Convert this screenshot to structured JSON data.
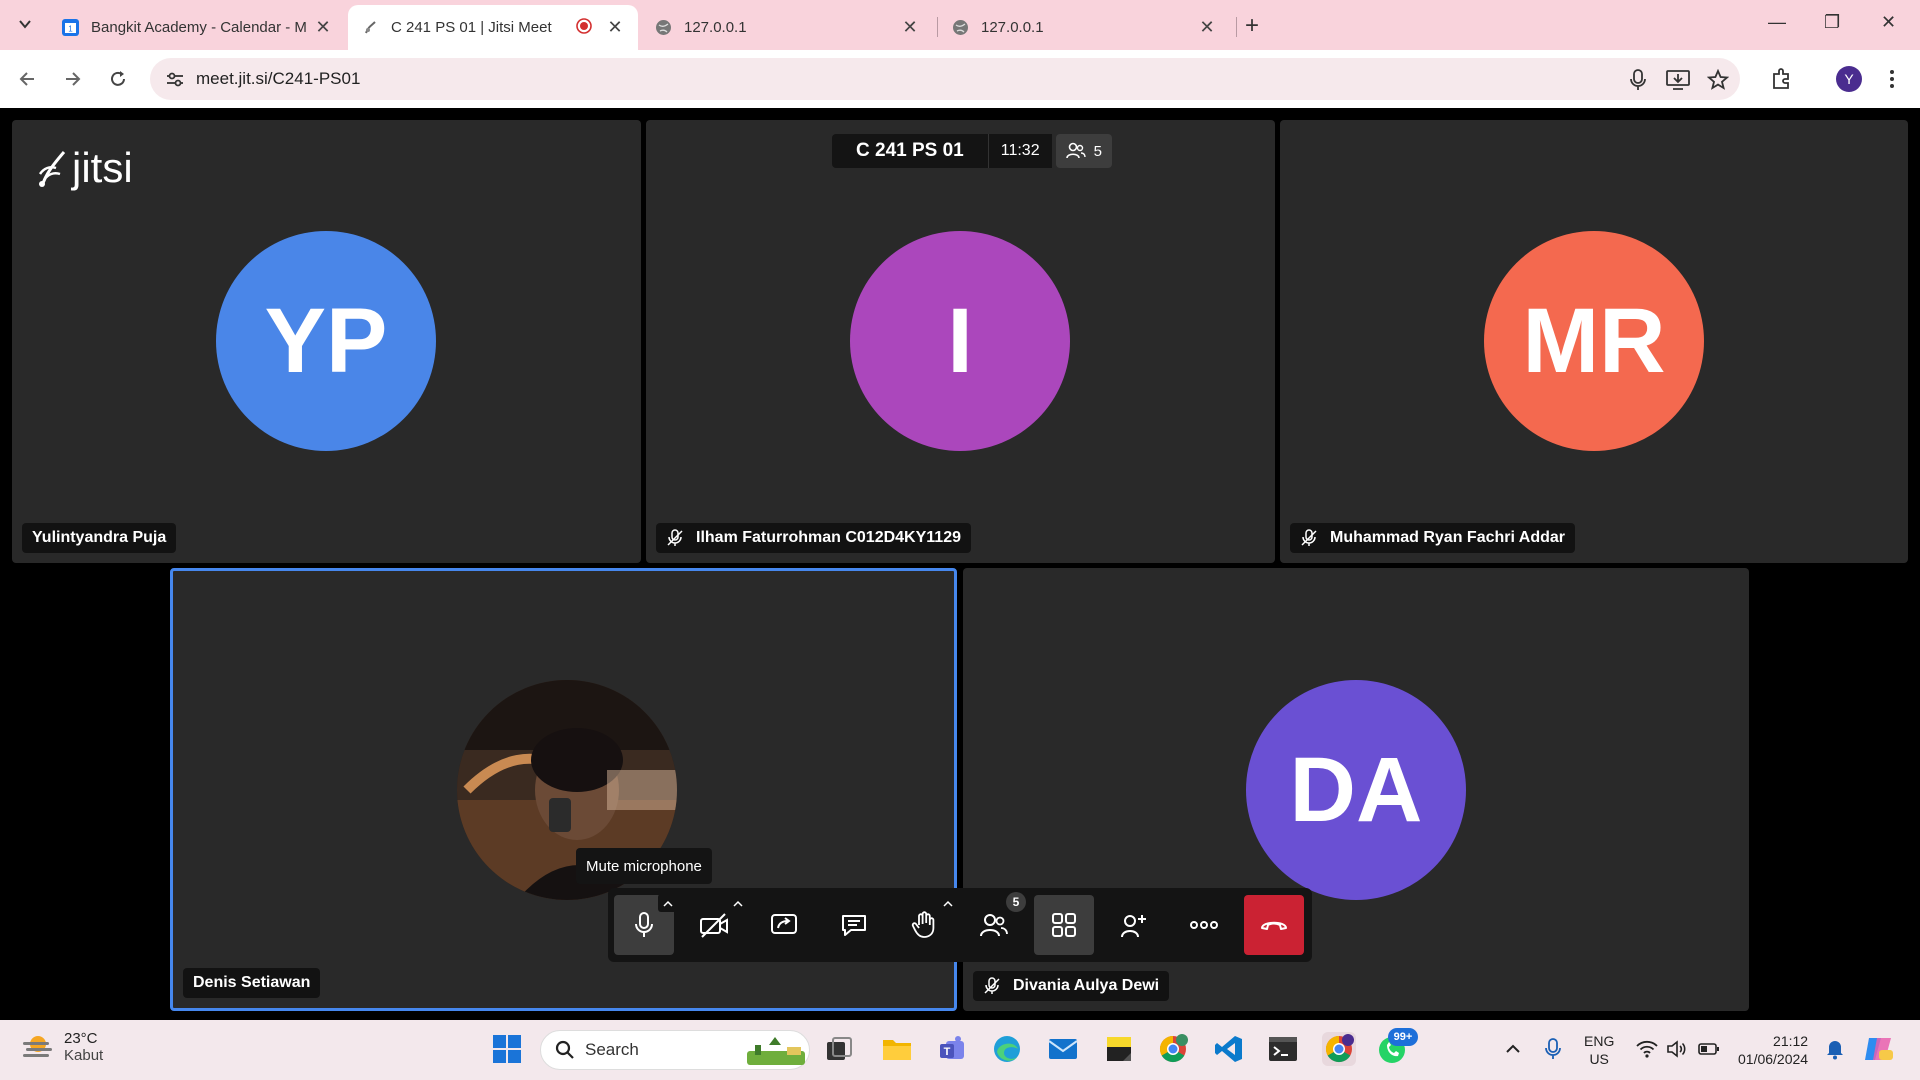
{
  "browser": {
    "tabs": [
      {
        "title": "Bangkit Academy - Calendar - M",
        "close": "✕"
      },
      {
        "title": "C 241 PS 01 | Jitsi Meet",
        "close": "✕"
      },
      {
        "title": "127.0.0.1",
        "close": "✕"
      },
      {
        "title": "127.0.0.1",
        "close": "✕"
      }
    ],
    "new_tab": "+",
    "url": "meet.jit.si/C241-PS01",
    "profile_initial": "Y",
    "win_min": "—",
    "win_max": "❐",
    "win_close": "✕"
  },
  "meeting": {
    "logo_text": "jitsi",
    "conference_name": "C 241 PS 01",
    "timer": "11:32",
    "participant_count": "5",
    "tiles": [
      {
        "initials": "YP",
        "name": "Yulintyandra Puja",
        "color": "#4a86e8"
      },
      {
        "initials": "I",
        "name": "Ilham Faturrohman C012D4KY1129",
        "color": "#ab47bc"
      },
      {
        "initials": "MR",
        "name": "Muhammad Ryan Fachri Addar",
        "color": "#f4694f"
      },
      {
        "initials": "",
        "name": "Denis Setiawan",
        "color": "#3b2c22"
      },
      {
        "initials": "DA",
        "name": "Divania Aulya Dewi",
        "color": "#6a50d3"
      }
    ],
    "tooltip": "Mute microphone",
    "participants_badge": "5"
  },
  "colors": {
    "active_border": "#4687ed",
    "hangup": "#cb2233",
    "tile_bg": "#292929"
  },
  "taskbar": {
    "temperature": "23°C",
    "weather": "Kabut",
    "search_label": "Search",
    "whatsapp_badge": "99+",
    "chrome_badge": "Y",
    "lang_top": "ENG",
    "lang_bottom": "US",
    "time": "21:12",
    "date": "01/06/2024"
  }
}
